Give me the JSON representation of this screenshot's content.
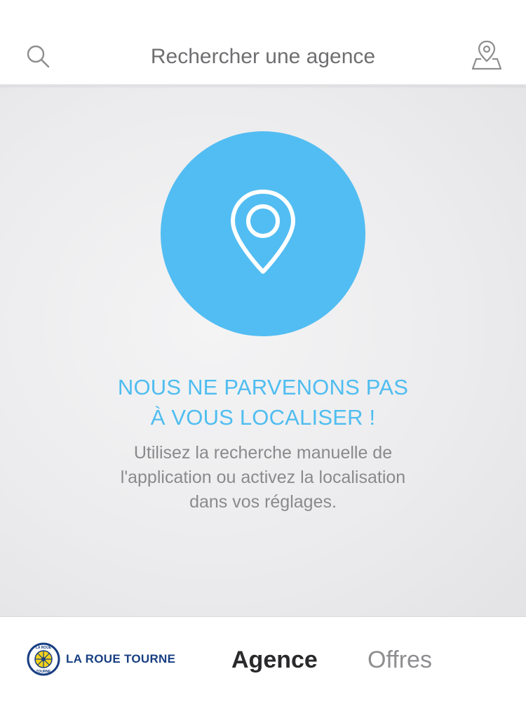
{
  "header": {
    "search_placeholder": "Rechercher une agence",
    "search_icon": "search-icon",
    "map_icon": "map-pin-icon"
  },
  "main": {
    "icon": "location-pin-icon",
    "circle_color": "#52bdf2",
    "title_lines": [
      "NOUS NE PARVENONS PAS",
      "À VOUS LOCALISER !"
    ],
    "title_color": "#4fbdf0",
    "body_lines": [
      "Utilisez la recherche manuelle de",
      "l'application ou activez la localisation",
      "dans vos réglages."
    ]
  },
  "tabbar": {
    "brand_name": "LA ROUE TOURNE",
    "brand_logo_text": [
      "LA ROUE",
      "TOURNE"
    ],
    "brand_color": "#173e82",
    "tabs": [
      {
        "label": "Agence",
        "selected": true
      },
      {
        "label": "Offres",
        "selected": false
      }
    ]
  }
}
